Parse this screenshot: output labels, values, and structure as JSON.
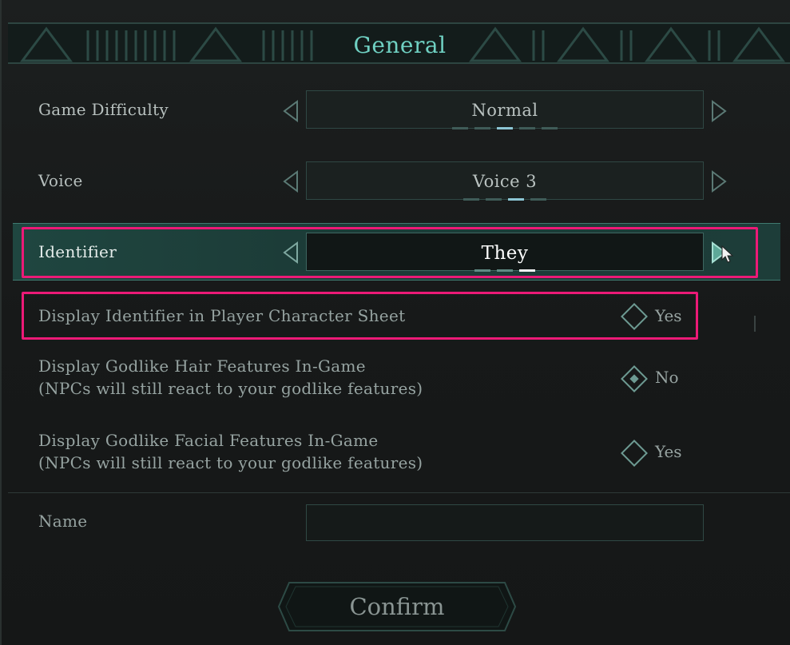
{
  "header": {
    "title": "General"
  },
  "settings": {
    "difficulty": {
      "label": "Game Difficulty",
      "value": "Normal",
      "pip_count": 5,
      "active_index": 2
    },
    "voice": {
      "label": "Voice",
      "value": "Voice 3",
      "pip_count": 4,
      "active_index": 2
    },
    "identifier": {
      "label": "Identifier",
      "value": "They",
      "pip_count": 3,
      "active_index": 2
    }
  },
  "options": [
    {
      "label_line1": "Display Identifier in Player Character Sheet",
      "label_line2": "",
      "value": "Yes",
      "checked": false
    },
    {
      "label_line1": "Display Godlike Hair Features In-Game",
      "label_line2": "(NPCs will still react to your godlike features)",
      "value": "No",
      "checked": true
    },
    {
      "label_line1": "Display Godlike Facial Features In-Game",
      "label_line2": "(NPCs will still react to your godlike features)",
      "value": "Yes",
      "checked": false
    }
  ],
  "name": {
    "label": "Name",
    "value": ""
  },
  "confirm": {
    "label": "Confirm"
  },
  "colors": {
    "accent": "#6fd0c2",
    "highlight": "#ec1a77",
    "selected_row": "#1f4640"
  },
  "icons": [
    "arrow-left-icon",
    "arrow-right-icon",
    "diamond-toggle-icon",
    "cursor-icon"
  ]
}
